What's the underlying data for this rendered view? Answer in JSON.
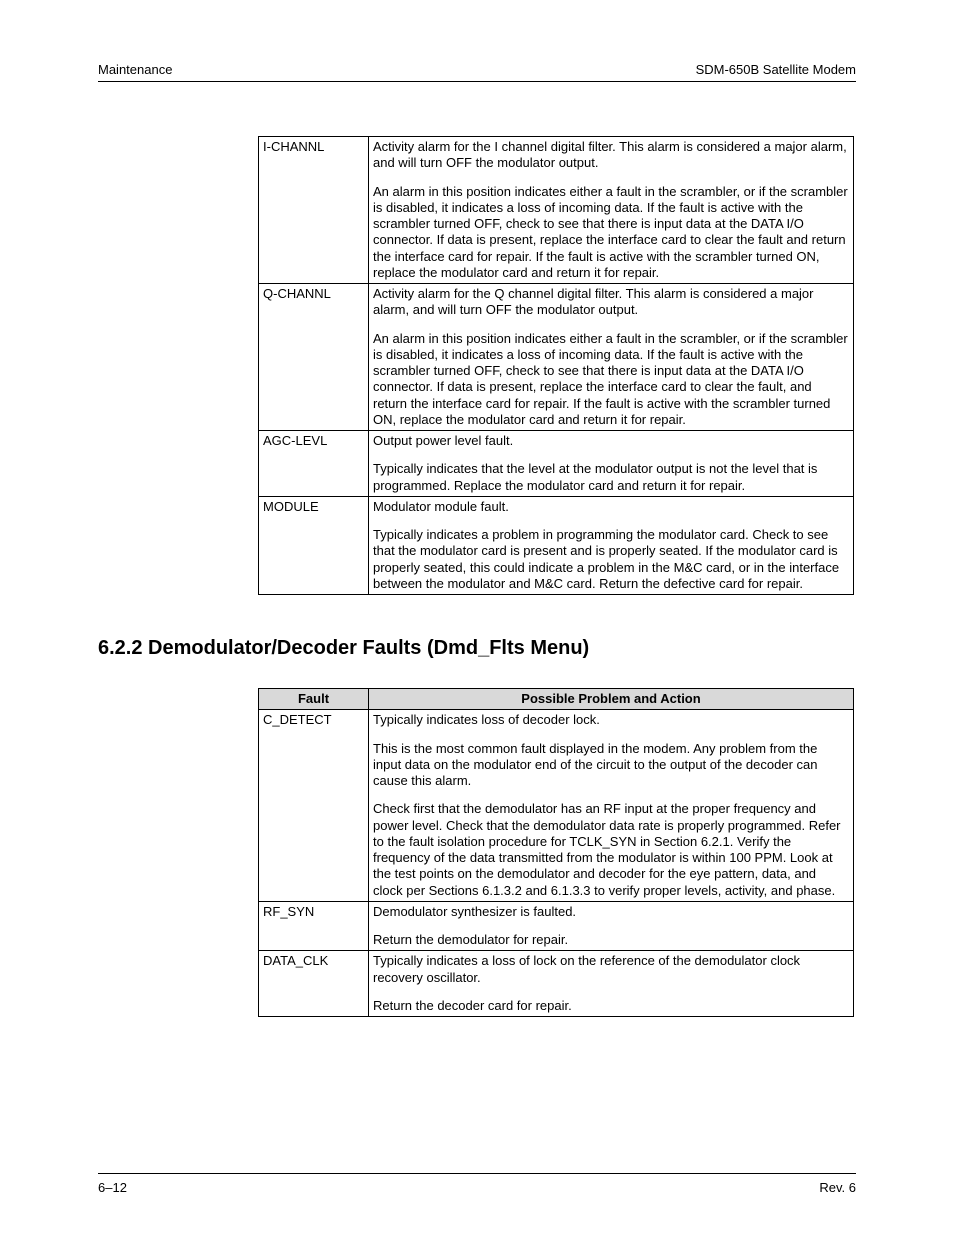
{
  "header": {
    "left": "Maintenance",
    "right": "SDM-650B Satellite Modem"
  },
  "table1": {
    "rows": [
      {
        "fault": "I-CHANNL",
        "paras": [
          "Activity alarm for the I channel digital filter. This alarm is considered a major alarm, and will turn OFF the modulator output.",
          "An alarm in this position indicates either a fault in the scrambler, or if the scrambler is disabled, it indicates a loss of incoming data. If the fault is active with the scrambler turned OFF, check to see that there is input data at the DATA I/O connector. If data is present, replace the interface card to clear the fault and return the interface card for repair. If the fault is active with the scrambler turned ON, replace the modulator card and return it for repair."
        ]
      },
      {
        "fault": "Q-CHANNL",
        "paras": [
          "Activity alarm for the Q channel digital filter. This alarm is considered a major alarm, and will turn OFF the modulator output.",
          "An alarm in this position indicates either a fault in the scrambler, or if the scrambler is disabled, it indicates a loss of incoming data. If the fault is active with the scrambler turned OFF, check to see that there is input data at the DATA I/O connector. If data is present, replace the interface card to clear the fault, and return the interface card for repair. If the fault is active with the scrambler turned ON, replace the modulator card and return it for repair."
        ]
      },
      {
        "fault": "AGC-LEVL",
        "paras": [
          "Output power level fault.",
          "Typically indicates that the level at the modulator output is not the level that is programmed. Replace the modulator card and return it for repair."
        ]
      },
      {
        "fault": "MODULE",
        "paras": [
          "Modulator module fault.",
          "Typically indicates a problem in programming the modulator card. Check to see that the modulator card is present and is properly seated. If the modulator card is properly seated, this could indicate a problem in the M&C card, or in the interface between the modulator and M&C card. Return the defective card for repair."
        ]
      }
    ]
  },
  "sectionHeading": "6.2.2  Demodulator/Decoder Faults (Dmd_Flts Menu)",
  "table2": {
    "headers": {
      "fault": "Fault",
      "action": "Possible Problem and Action"
    },
    "rows": [
      {
        "fault": "C_DETECT",
        "paras": [
          "Typically indicates loss of decoder lock.",
          "This is the most common fault displayed in the modem. Any problem from the input data on the modulator end of the circuit to the output of the decoder can cause this alarm.",
          "Check first that the demodulator has an RF input at the proper frequency and power level. Check that the demodulator data rate is properly programmed. Refer to the fault isolation procedure for TCLK_SYN in Section 6.2.1. Verify the frequency of the data transmitted from the modulator is within 100 PPM. Look at the test points on the demodulator and decoder for the eye pattern, data, and clock per Sections 6.1.3.2 and 6.1.3.3 to verify proper levels, activity, and phase."
        ]
      },
      {
        "fault": "RF_SYN",
        "paras": [
          "Demodulator synthesizer is faulted.",
          "Return the demodulator for repair."
        ]
      },
      {
        "fault": "DATA_CLK",
        "paras": [
          "Typically indicates a loss of lock on the reference of the demodulator clock recovery oscillator.",
          "Return the decoder card for repair."
        ]
      }
    ]
  },
  "footer": {
    "left": "6–12",
    "right": "Rev. 6"
  }
}
